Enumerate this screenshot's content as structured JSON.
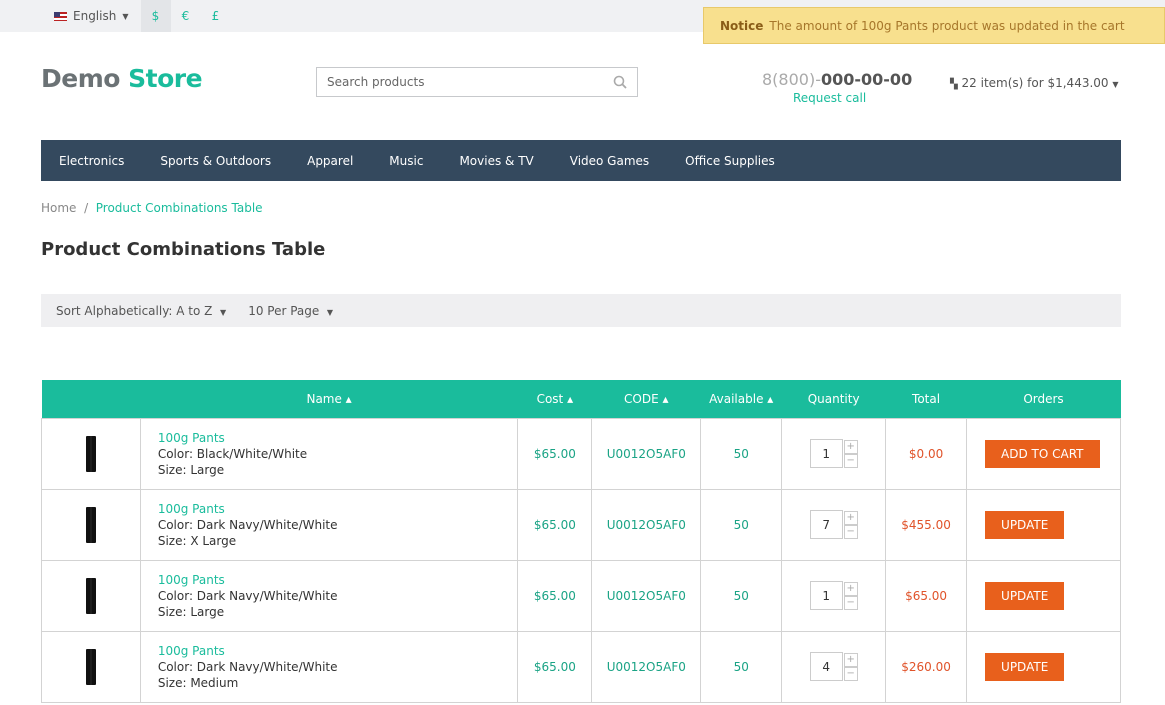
{
  "topbar": {
    "language": "English",
    "currencies": [
      "$",
      "€",
      "£"
    ],
    "active_currency": "$"
  },
  "notice": {
    "label": "Notice",
    "message": "The amount of 100g Pants product was updated in the cart"
  },
  "header": {
    "logo_part1": "Demo",
    "logo_part2": "Store",
    "search_placeholder": "Search products",
    "phone_prefix": "8(800)-",
    "phone_number": "000-00-00",
    "request_call": "Request call",
    "cart": "22 item(s) for $1,443.00"
  },
  "nav": [
    "Electronics",
    "Sports & Outdoors",
    "Apparel",
    "Music",
    "Movies & TV",
    "Video Games",
    "Office Supplies"
  ],
  "breadcrumb": {
    "home": "Home",
    "current": "Product Combinations Table"
  },
  "page_title": "Product Combinations Table",
  "sort": {
    "sort_label": "Sort Alphabetically: A to Z",
    "per_page": "10 Per Page"
  },
  "table": {
    "headers": [
      "",
      "Name ▴",
      "Cost ▴",
      "CODE ▴",
      "Available ▴",
      "Quantity",
      "Total",
      "Orders"
    ],
    "rows": [
      {
        "name": "100g Pants",
        "color": "Color: Black/White/White",
        "size": "Size: Large",
        "cost": "$65.00",
        "code": "U0012O5AF0",
        "available": "50",
        "qty": "1",
        "total": "$0.00",
        "action": "ADD TO CART"
      },
      {
        "name": "100g Pants",
        "color": "Color: Dark Navy/White/White",
        "size": "Size: X Large",
        "cost": "$65.00",
        "code": "U0012O5AF0",
        "available": "50",
        "qty": "7",
        "total": "$455.00",
        "action": "UPDATE"
      },
      {
        "name": "100g Pants",
        "color": "Color: Dark Navy/White/White",
        "size": "Size: Large",
        "cost": "$65.00",
        "code": "U0012O5AF0",
        "available": "50",
        "qty": "1",
        "total": "$65.00",
        "action": "UPDATE"
      },
      {
        "name": "100g Pants",
        "color": "Color: Dark Navy/White/White",
        "size": "Size: Medium",
        "cost": "$65.00",
        "code": "U0012O5AF0",
        "available": "50",
        "qty": "4",
        "total": "$260.00",
        "action": "UPDATE"
      }
    ]
  },
  "colors": {
    "accent": "#1abc9c",
    "nav": "#34495e",
    "button": "#e8601c",
    "notice": "#f8e08e"
  }
}
